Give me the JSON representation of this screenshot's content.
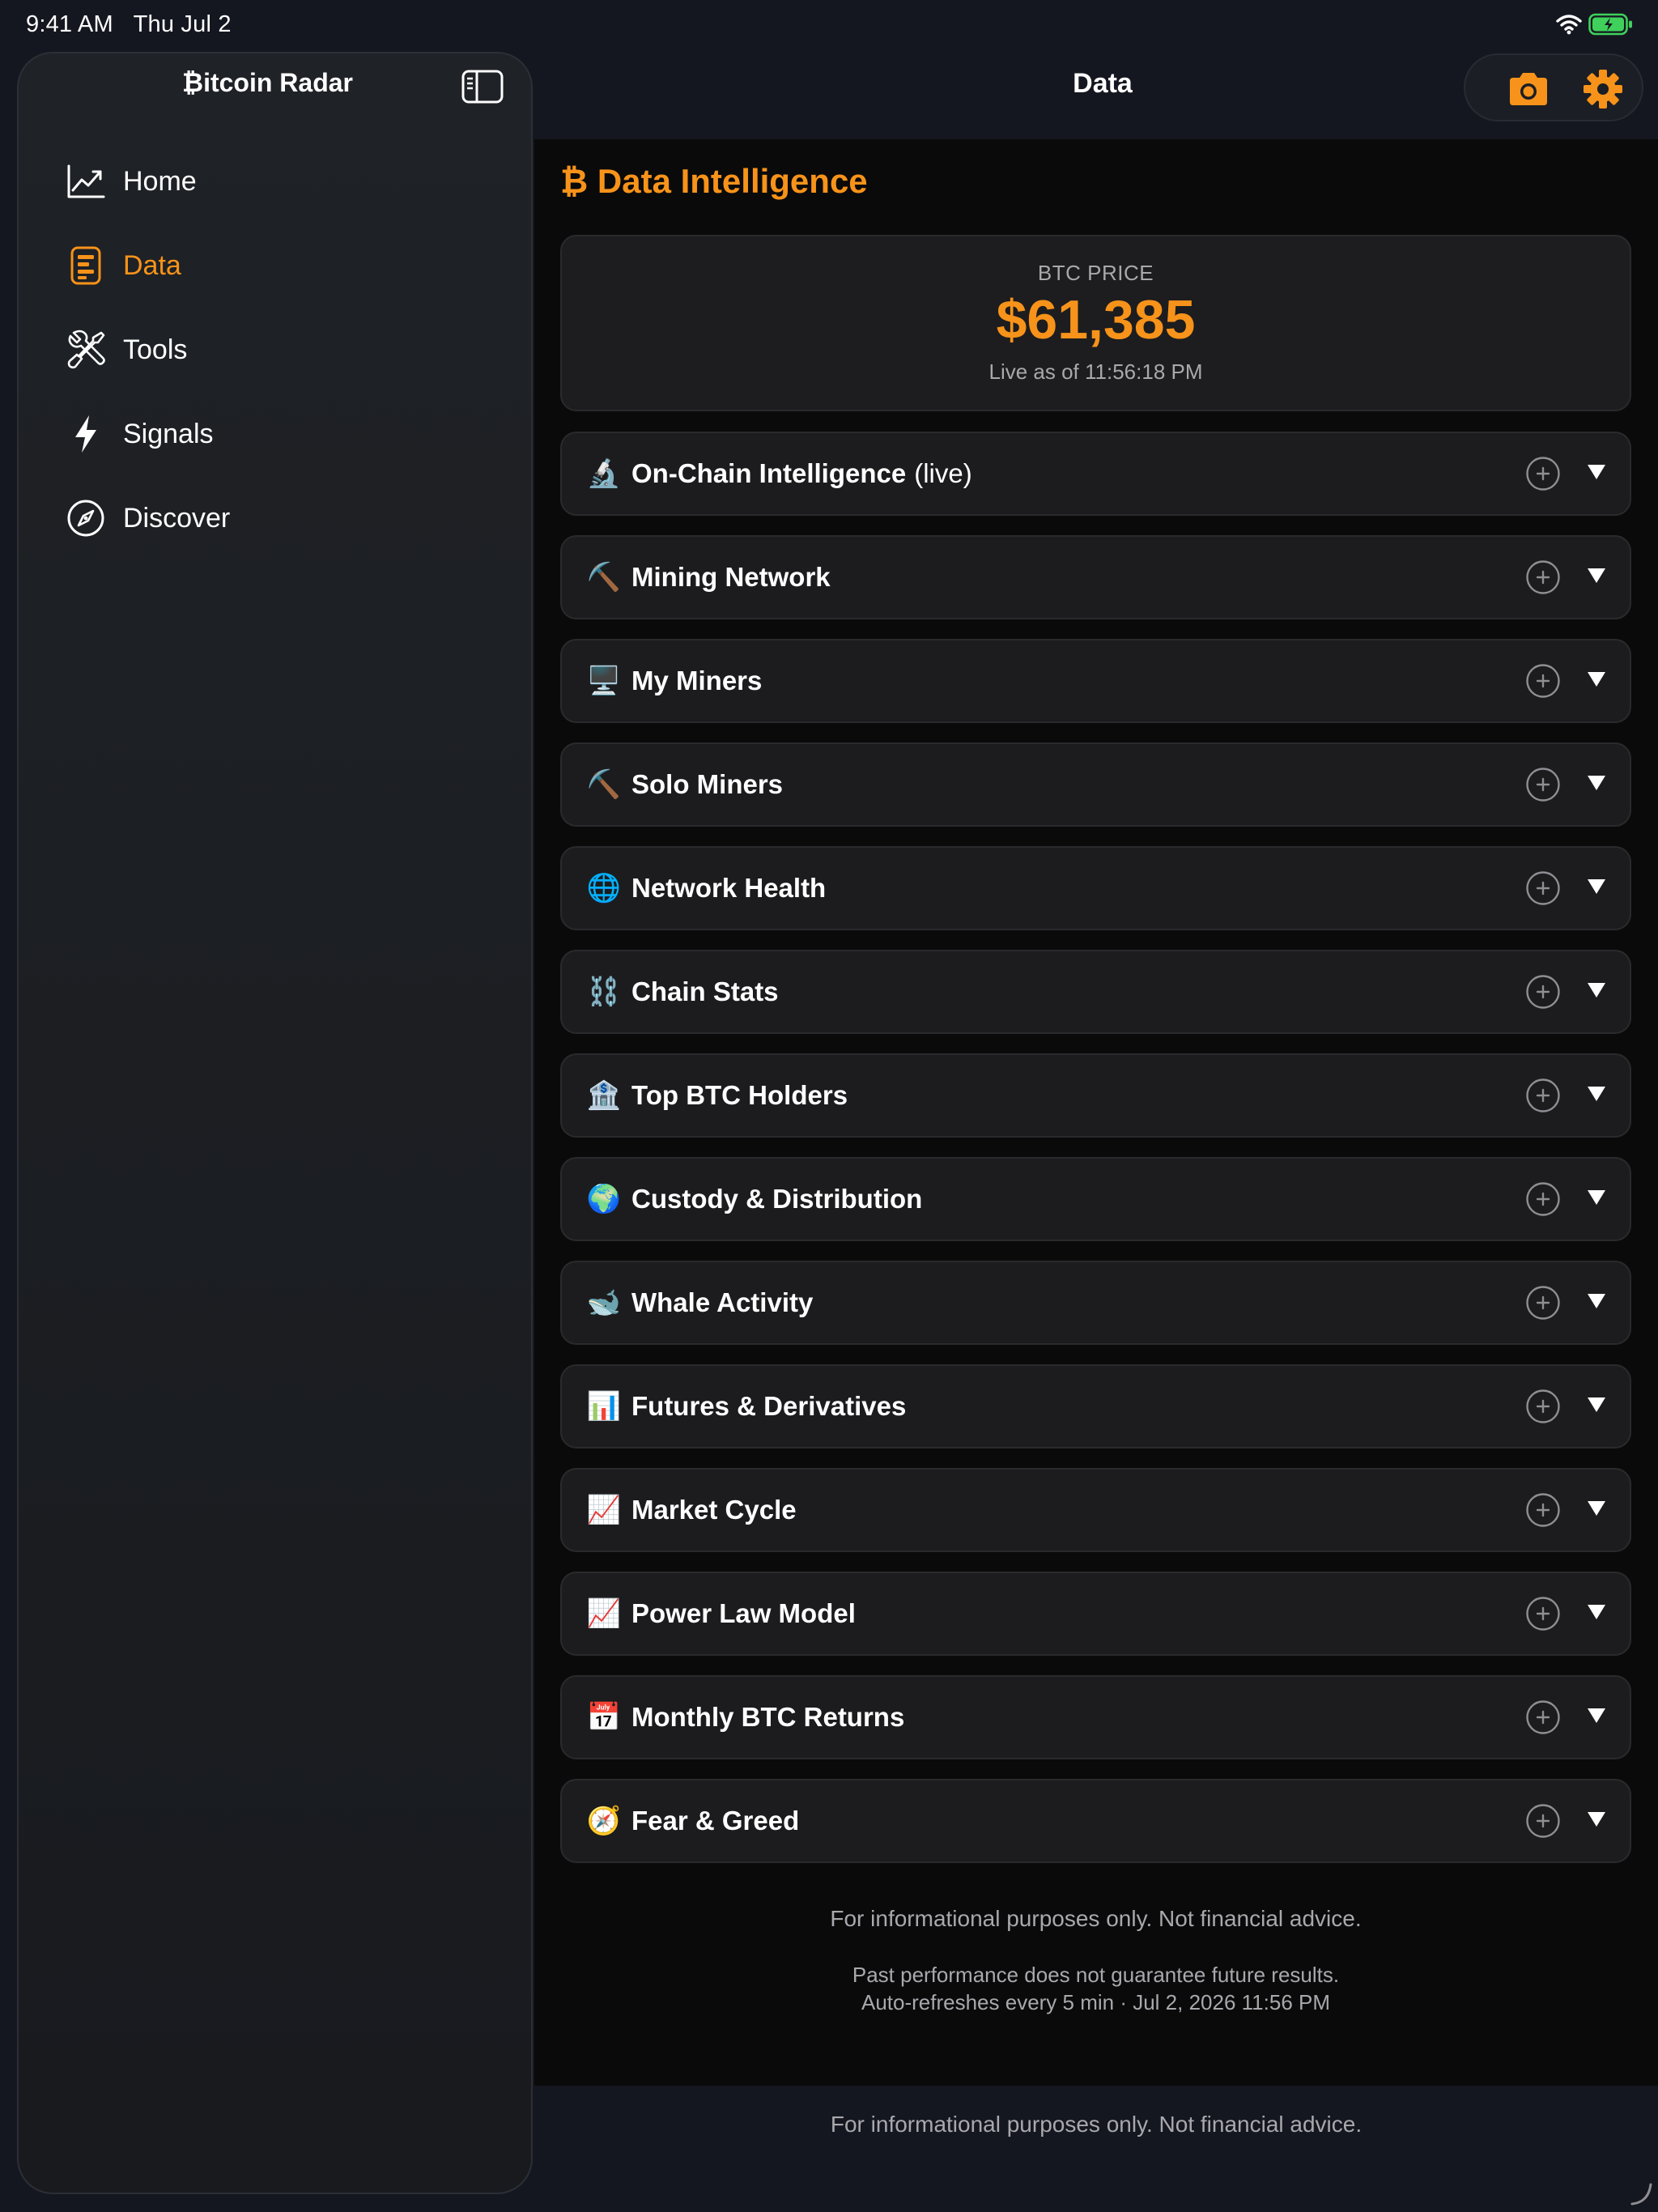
{
  "status": {
    "time": "9:41 AM",
    "date": "Thu Jul 2"
  },
  "sidebar": {
    "title": "₿itcoin Radar",
    "items": [
      {
        "label": "Home",
        "icon": "chart-line-icon"
      },
      {
        "label": "Data",
        "icon": "document-icon",
        "active": true
      },
      {
        "label": "Tools",
        "icon": "wrench-screwdriver-icon"
      },
      {
        "label": "Signals",
        "icon": "bolt-icon"
      },
      {
        "label": "Discover",
        "icon": "compass-icon"
      }
    ]
  },
  "topbar": {
    "title": "Data"
  },
  "main": {
    "title": "₿ Data Intelligence",
    "price": {
      "label": "BTC PRICE",
      "value": "$61,385",
      "live": "Live as of 11:56:18 PM"
    },
    "sections": [
      {
        "emoji": "🔬",
        "label": "On-Chain Intelligence",
        "extra": "(live)"
      },
      {
        "emoji": "⛏️",
        "label": "Mining Network"
      },
      {
        "emoji": "🖥️",
        "label": "My Miners"
      },
      {
        "emoji": "⛏️",
        "label": "Solo Miners"
      },
      {
        "emoji": "🌐",
        "label": "Network Health"
      },
      {
        "emoji": "⛓️",
        "label": "Chain Stats"
      },
      {
        "emoji": "🏦",
        "label": "Top BTC Holders"
      },
      {
        "emoji": "🌍",
        "label": "Custody & Distribution"
      },
      {
        "emoji": "🐋",
        "label": "Whale Activity"
      },
      {
        "emoji": "📊",
        "label": "Futures & Derivatives"
      },
      {
        "emoji": "📈",
        "label": "Market Cycle"
      },
      {
        "emoji": "📈",
        "label": "Power Law Model"
      },
      {
        "emoji": "📅",
        "label": "Monthly BTC Returns"
      },
      {
        "emoji": "🧭",
        "label": "Fear & Greed"
      }
    ],
    "disclaimer": "For informational purposes only. Not financial advice.",
    "past_performance": "Past performance does not guarantee future results.",
    "refresh": "Auto-refreshes every 5 min · Jul 2, 2026 11:56 PM"
  },
  "bottom_note": "For informational purposes only. Not financial advice.",
  "colors": {
    "accent": "#f7931a",
    "background": "#151720",
    "card": "#1c1c1e"
  }
}
